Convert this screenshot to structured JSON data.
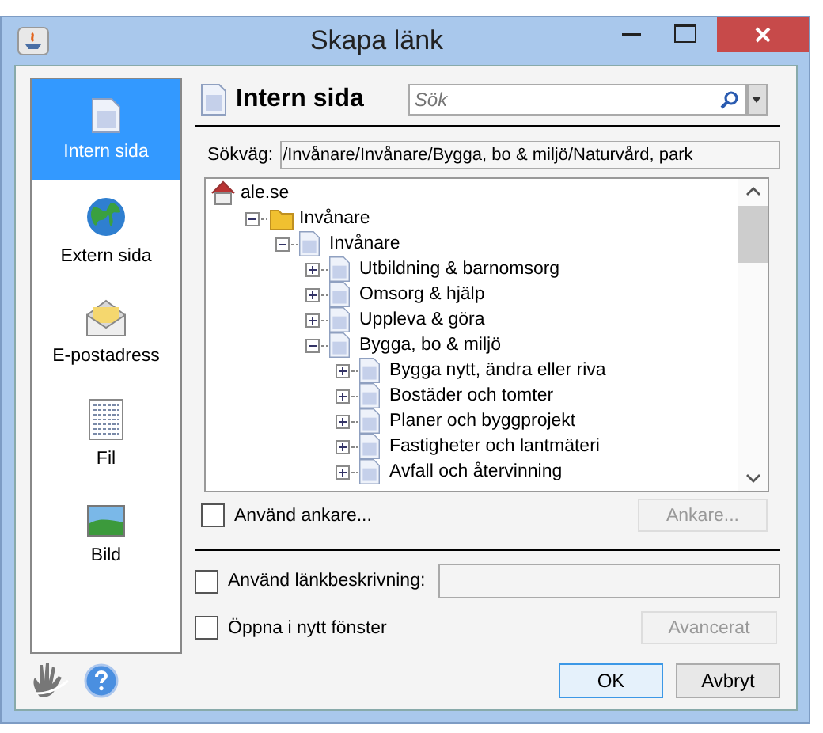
{
  "window": {
    "title": "Skapa länk"
  },
  "sidebar": {
    "items": [
      {
        "label": "Intern sida",
        "kind": "page",
        "selected": true
      },
      {
        "label": "Extern sida",
        "kind": "globe",
        "selected": false
      },
      {
        "label": "E-postadress",
        "kind": "mail",
        "selected": false
      },
      {
        "label": "Fil",
        "kind": "file",
        "selected": false
      },
      {
        "label": "Bild",
        "kind": "image",
        "selected": false
      }
    ]
  },
  "header": {
    "title": "Intern sida",
    "search": {
      "placeholder": "Sök"
    }
  },
  "path": {
    "label": "Sökväg:",
    "value": "/Invånare/Invånare/Bygga, bo & miljö/Naturvård, park"
  },
  "tree": [
    {
      "label": "ale.se",
      "kind": "home",
      "children": [
        {
          "label": "Invånare",
          "kind": "folder",
          "expanded": true,
          "children": [
            {
              "label": "Invånare",
              "kind": "page",
              "expanded": true,
              "children": [
                {
                  "label": "Utbildning & barnomsorg",
                  "kind": "page",
                  "expanded": false
                },
                {
                  "label": "Omsorg & hjälp",
                  "kind": "page",
                  "expanded": false
                },
                {
                  "label": "Uppleva & göra",
                  "kind": "page",
                  "expanded": false
                },
                {
                  "label": "Bygga, bo & miljö",
                  "kind": "page",
                  "expanded": true,
                  "children": [
                    {
                      "label": "Bygga nytt, ändra eller riva",
                      "kind": "page",
                      "expanded": false
                    },
                    {
                      "label": "Bostäder och tomter",
                      "kind": "page",
                      "expanded": false
                    },
                    {
                      "label": "Planer och byggprojekt",
                      "kind": "page",
                      "expanded": false
                    },
                    {
                      "label": "Fastigheter och lantmäteri",
                      "kind": "page",
                      "expanded": false
                    },
                    {
                      "label": "Avfall och återvinning",
                      "kind": "page",
                      "expanded": false
                    }
                  ]
                }
              ]
            }
          ]
        }
      ]
    }
  ],
  "anchor": {
    "label": "Använd ankare...",
    "checked": false,
    "button": "Ankare...",
    "button_disabled": true
  },
  "description": {
    "label": "Använd länkbeskrivning:",
    "checked": false
  },
  "new_window": {
    "label": "Öppna i nytt fönster",
    "checked": false,
    "button": "Avancerat",
    "button_disabled": true
  },
  "buttons": [
    {
      "label": "OK",
      "default": true
    },
    {
      "label": "Avbryt",
      "default": false
    }
  ]
}
